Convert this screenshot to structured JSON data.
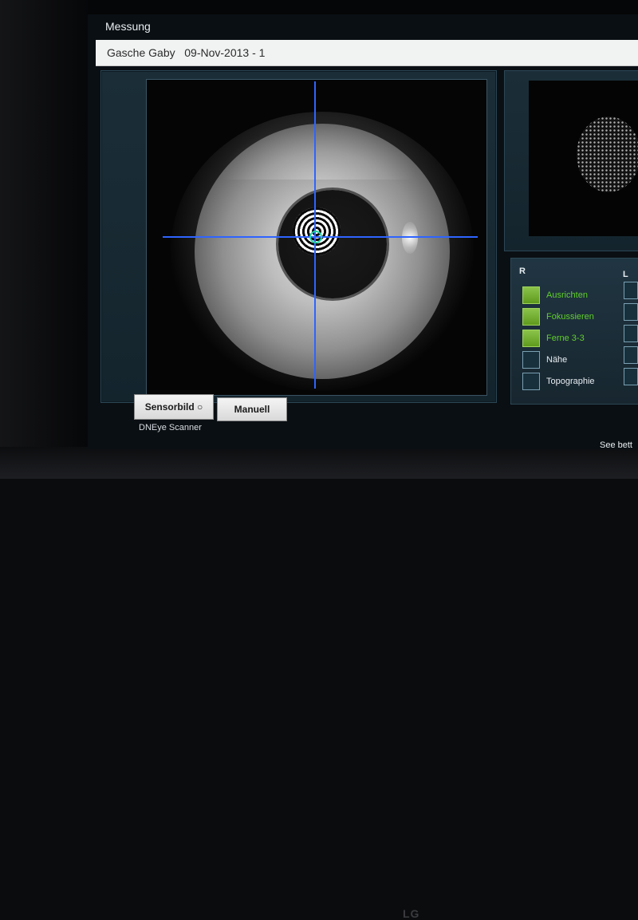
{
  "window": {
    "title": "Messung"
  },
  "patient": {
    "header": "Gasche Gaby   09-Nov-2013 - 1"
  },
  "scanner": {
    "sensor_button_label": "Sensorbild ○",
    "manual_button_label": "Manuell",
    "scanner_name": "DNEye Scanner"
  },
  "status": {
    "r_label": "R",
    "l_label": "L",
    "steps": [
      {
        "label": "Ausrichten",
        "done": true
      },
      {
        "label": "Fokussieren",
        "done": true
      },
      {
        "label": "Ferne 3-3",
        "done": true
      },
      {
        "label": "Nähe",
        "done": false
      },
      {
        "label": "Topographie",
        "done": false
      }
    ]
  },
  "footer": {
    "text": "See bett"
  },
  "monitor": {
    "brand": "LG"
  },
  "colors": {
    "crosshair": "#2f64ff",
    "target": "#25d0a4",
    "done_green": "#61cf2b"
  }
}
